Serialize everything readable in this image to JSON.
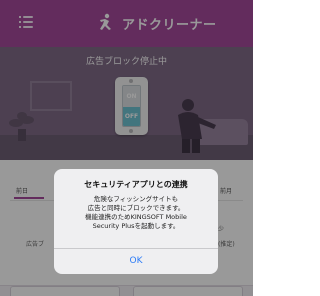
{
  "header": {
    "title": "アドクリーナー",
    "menu_icon": "menu-icon",
    "logo_icon": "runner-logo-icon",
    "background_color": "#a64a9c"
  },
  "hero": {
    "status_text": "広告ブロック停止中",
    "switch": {
      "on_label": "ON",
      "off_label": "OFF",
      "state": "off",
      "off_color": "#6ec3d2"
    }
  },
  "content": {
    "tabs": [
      "前日",
      "前月"
    ],
    "row_label": "広告ブ",
    "right_peek": [
      "少",
      "(推定)"
    ]
  },
  "dialog": {
    "title": "セキュリティアプリとの連携",
    "message_lines": [
      "危険なフィッシングサイトも",
      "広告と同時にブロックできます。",
      "機能連携のためKINGSOFT Mobile",
      "Security Plusを起動します。"
    ],
    "ok_label": "OK",
    "ok_color": "#2d7cf6"
  }
}
